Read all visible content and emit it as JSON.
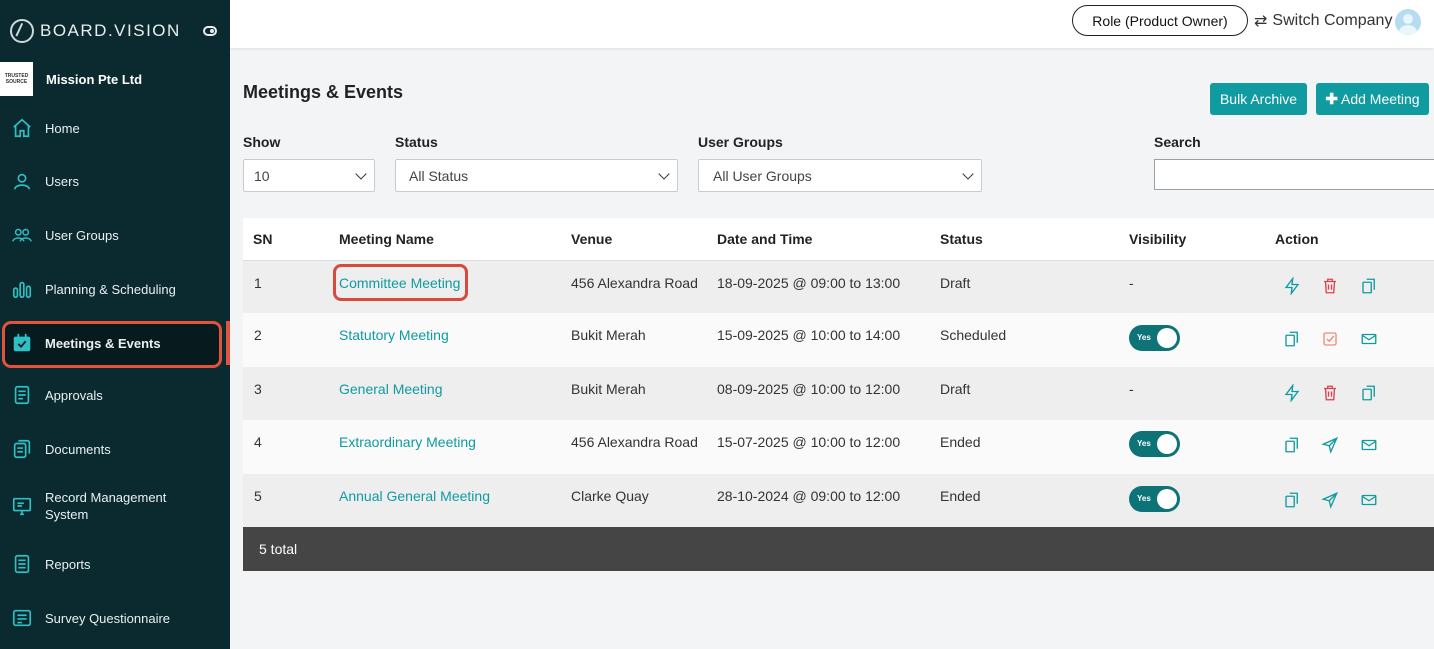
{
  "brand": {
    "name": "BOARD.VISION"
  },
  "company": {
    "logo_text": "TRUSTED SOURCE",
    "name": "Mission Pte Ltd"
  },
  "nav": [
    {
      "label": "Home",
      "icon": "home-icon"
    },
    {
      "label": "Users",
      "icon": "user-icon"
    },
    {
      "label": "User Groups",
      "icon": "users-icon"
    },
    {
      "label": "Planning & Scheduling",
      "icon": "chart-bars-icon"
    },
    {
      "label": "Meetings & Events",
      "icon": "calendar-check-icon",
      "active": true
    },
    {
      "label": "Approvals",
      "icon": "document-check-icon"
    },
    {
      "label": "Documents",
      "icon": "documents-icon"
    },
    {
      "label": "Record Management System",
      "icon": "monitor-icon"
    },
    {
      "label": "Reports",
      "icon": "report-icon"
    },
    {
      "label": "Survey Questionnaire",
      "icon": "survey-icon"
    }
  ],
  "topbar": {
    "role": "Role (Product Owner)",
    "switch_company": "Switch Company"
  },
  "page": {
    "title": "Meetings & Events",
    "bulk_archive": "Bulk Archive",
    "add_meeting": "Add Meeting"
  },
  "filters": {
    "show_label": "Show",
    "show_value": "10",
    "status_label": "Status",
    "status_value": "All Status",
    "groups_label": "User Groups",
    "groups_value": "All User Groups",
    "search_label": "Search",
    "search_value": ""
  },
  "table": {
    "headers": [
      "SN",
      "Meeting Name",
      "Venue",
      "Date and Time",
      "Status",
      "Visibility",
      "Action"
    ],
    "rows": [
      {
        "sn": "1",
        "name": "Committee Meeting",
        "venue": "456 Alexandra Road",
        "datetime": "18-09-2025 @ 09:00 to 13:00",
        "status": "Draft",
        "visibility": "-",
        "actions": [
          "bolt-icon",
          "trash-icon",
          "copy-icon"
        ]
      },
      {
        "sn": "2",
        "name": "Statutory Meeting",
        "venue": "Bukit Merah",
        "datetime": "15-09-2025 @ 10:00 to 14:00",
        "status": "Scheduled",
        "visibility": "Yes",
        "actions": [
          "copy-icon",
          "checkbox-icon",
          "mail-icon"
        ]
      },
      {
        "sn": "3",
        "name": "General Meeting",
        "venue": "Bukit Merah",
        "datetime": "08-09-2025 @ 10:00 to 12:00",
        "status": "Draft",
        "visibility": "-",
        "actions": [
          "bolt-icon",
          "trash-icon",
          "copy-icon"
        ]
      },
      {
        "sn": "4",
        "name": "Extraordinary Meeting",
        "venue": "456 Alexandra Road",
        "datetime": "15-07-2025 @ 10:00 to 12:00",
        "status": "Ended",
        "visibility": "Yes",
        "actions": [
          "copy-icon",
          "send-icon",
          "mail-icon"
        ]
      },
      {
        "sn": "5",
        "name": "Annual General Meeting",
        "venue": "Clarke Quay",
        "datetime": "28-10-2024 @ 09:00 to 12:00",
        "status": "Ended",
        "visibility": "Yes",
        "actions": [
          "copy-icon",
          "send-icon",
          "mail-icon"
        ]
      }
    ],
    "footer": "5 total"
  },
  "colors": {
    "sidebar": "#0b2a30",
    "accent": "#0f9ba0",
    "highlight": "#d64b3d",
    "danger": "#e0404a"
  }
}
